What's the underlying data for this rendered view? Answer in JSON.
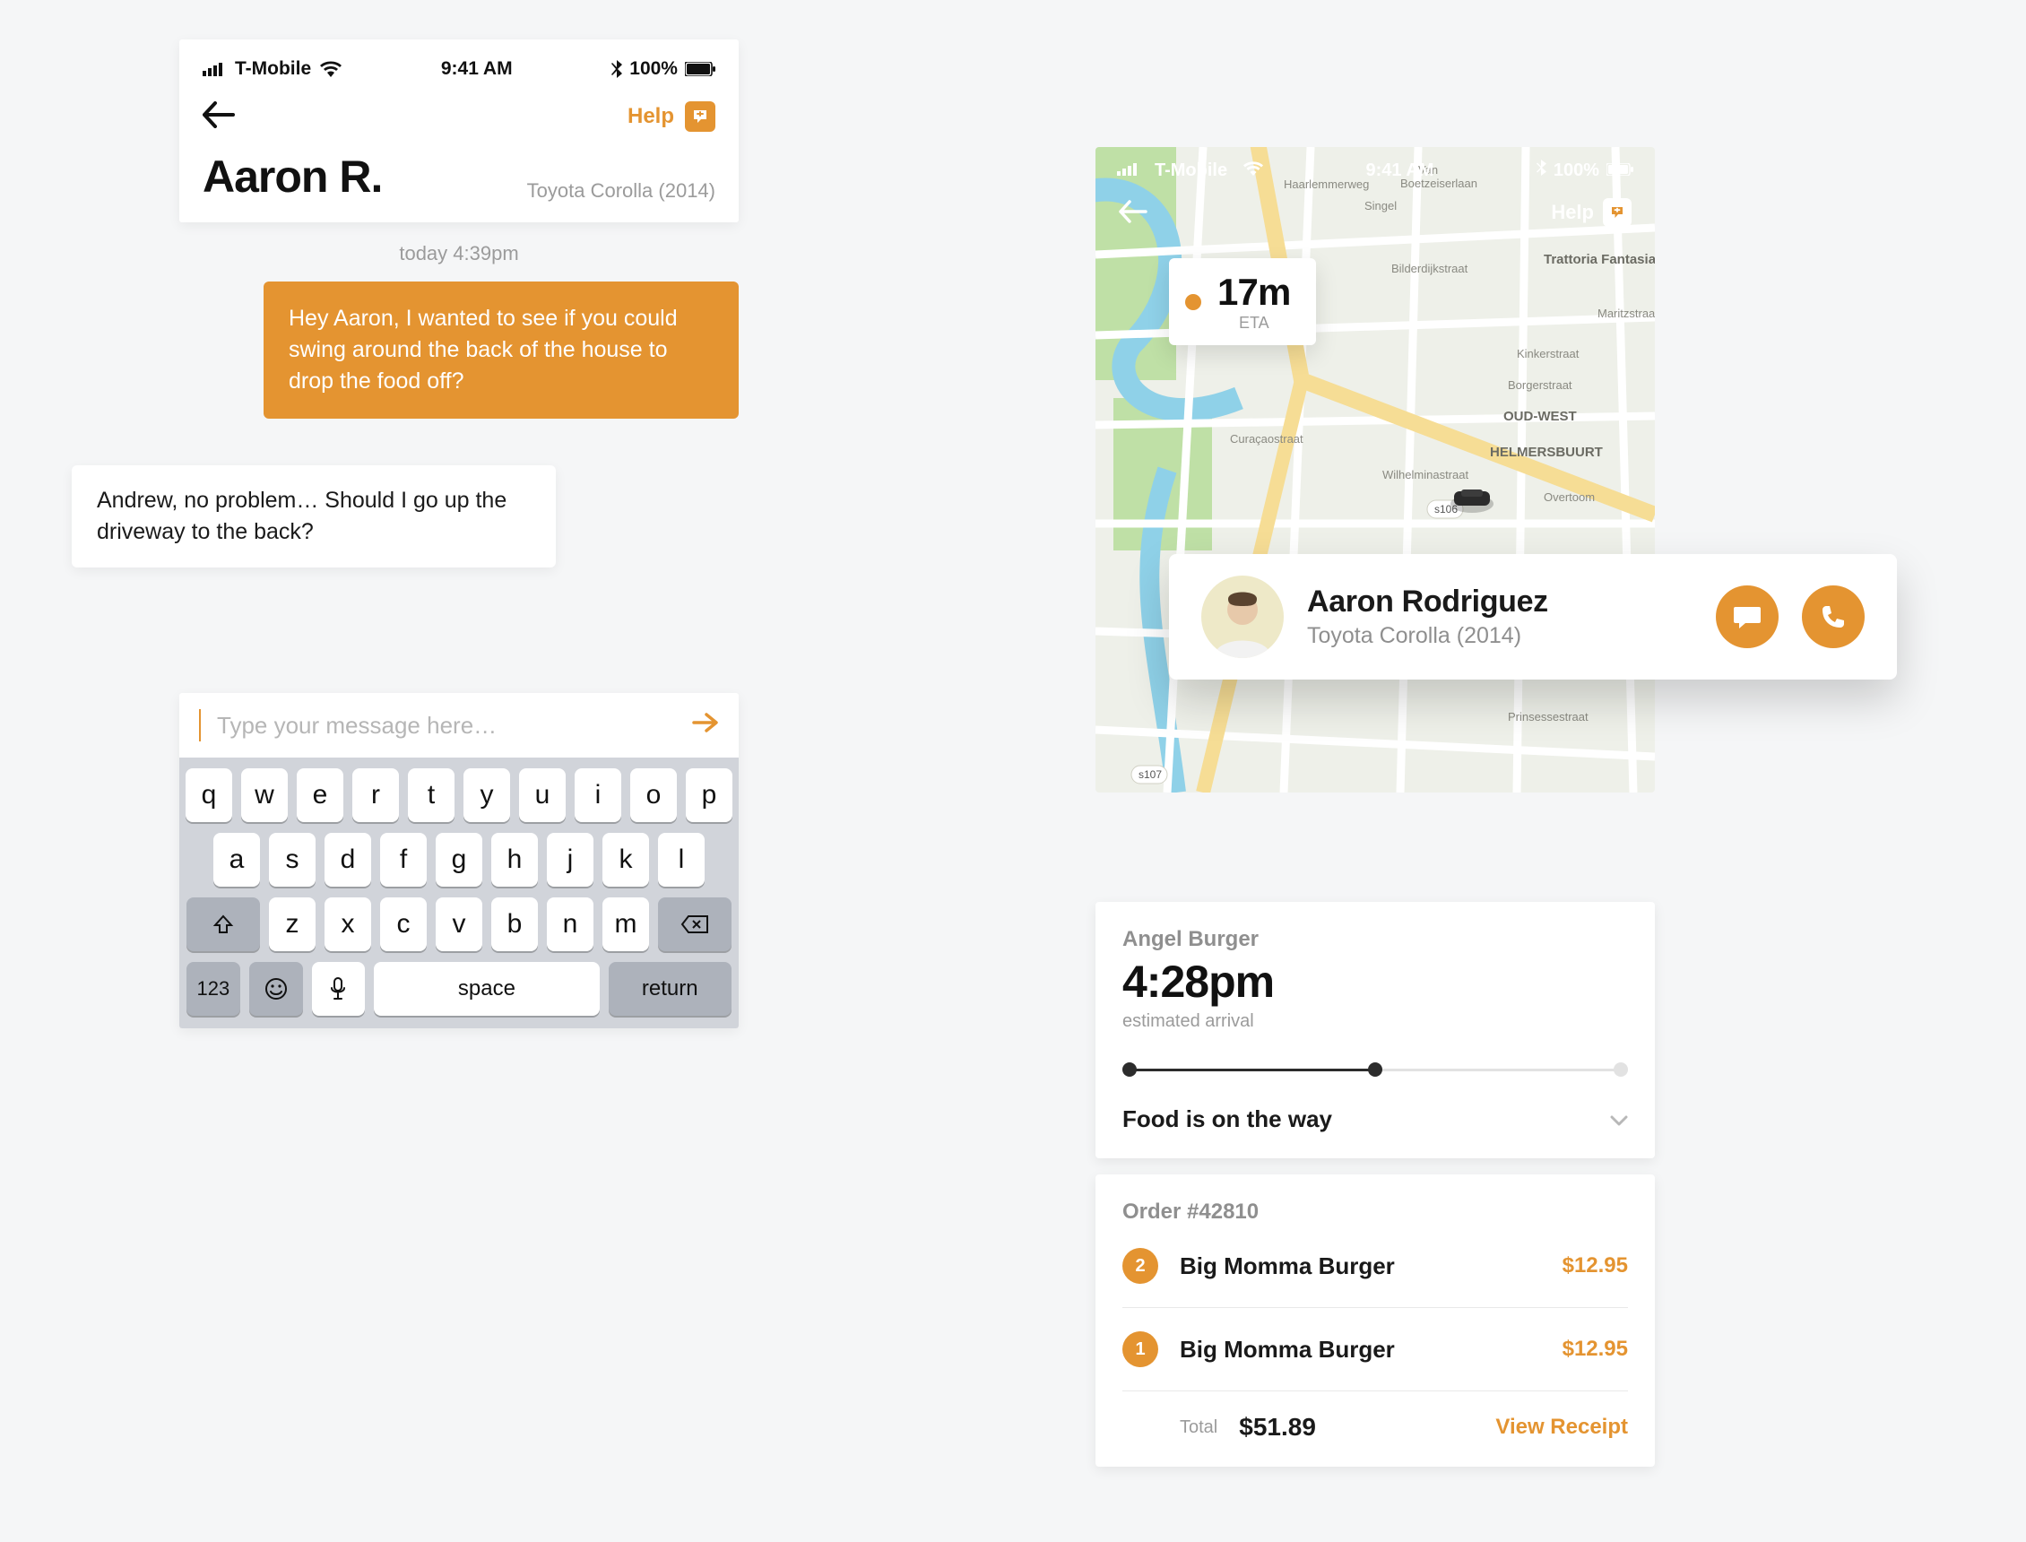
{
  "colors": {
    "accent": "#E49431"
  },
  "status": {
    "carrier": "T-Mobile",
    "time": "9:41 AM",
    "battery": "100%"
  },
  "chat": {
    "help_label": "Help",
    "driver_name": "Aaron R.",
    "car": "Toyota Corolla (2014)",
    "timestamp": "today 4:39pm",
    "outgoing": "Hey Aaron, I wanted to see if you could swing around the back of the house to drop the food off?",
    "incoming": "Andrew, no problem… Should I go up the driveway to the back?",
    "input_placeholder": "Type your message here…"
  },
  "keyboard": {
    "row1": [
      "q",
      "w",
      "e",
      "r",
      "t",
      "y",
      "u",
      "i",
      "o",
      "p"
    ],
    "row2": [
      "a",
      "s",
      "d",
      "f",
      "g",
      "h",
      "j",
      "k",
      "l"
    ],
    "row3_mid": [
      "z",
      "x",
      "c",
      "v",
      "b",
      "n",
      "m"
    ],
    "num_key": "123",
    "space_key": "space",
    "return_key": "return"
  },
  "tracker": {
    "help_label": "Help",
    "eta_value": "17m",
    "eta_label": "ETA",
    "driver_name": "Aaron Rodriguez",
    "driver_car": "Toyota Corolla (2014)",
    "restaurant": "Angel Burger",
    "arrival_time": "4:28pm",
    "arrival_sub": "estimated arrival",
    "status_text": "Food is on the way",
    "order_title": "Order #42810",
    "items": [
      {
        "qty": "2",
        "name": "Big Momma Burger",
        "price": "$12.95"
      },
      {
        "qty": "1",
        "name": "Big Momma Burger",
        "price": "$12.95"
      }
    ],
    "total_label": "Total",
    "total_value": "$51.89",
    "receipt_label": "View Receipt"
  }
}
